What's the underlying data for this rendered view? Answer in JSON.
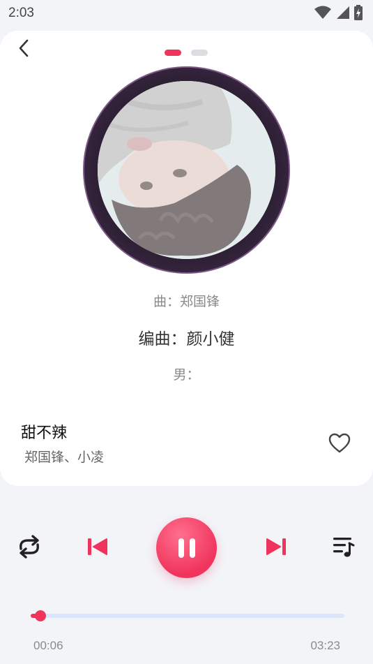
{
  "status_bar": {
    "time": "2:03",
    "icons": [
      "wifi-icon",
      "cell-signal-icon",
      "battery-charging-icon"
    ]
  },
  "pager": {
    "pages": 2,
    "active_index": 0
  },
  "colors": {
    "accent": "#f0345c",
    "track": "#dbe6fb",
    "background": "#f3f4f8"
  },
  "credits": {
    "composer": "曲：郑国锋",
    "arranger": "编曲：颜小健",
    "male": "男："
  },
  "song": {
    "title": "甜不辣",
    "artist": "郑国锋、小凌",
    "favorited": false
  },
  "controls": {
    "mode_icon": "repeat-icon",
    "prev_icon": "skip-previous-icon",
    "play_state_icon": "pause-icon",
    "next_icon": "skip-next-icon",
    "queue_icon": "playlist-icon"
  },
  "playback": {
    "elapsed": "00:06",
    "total": "03:23",
    "progress": 0.03
  }
}
